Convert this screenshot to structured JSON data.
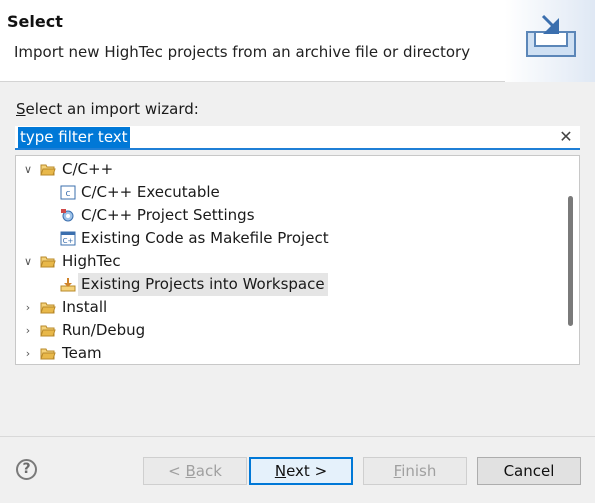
{
  "header": {
    "title": "Select",
    "description": "Import new HighTec projects from an archive file or directory"
  },
  "prompt": {
    "prefix": "S",
    "rest": "elect an import wizard:"
  },
  "filter": {
    "value": "type filter text",
    "clear": "✕"
  },
  "tree": {
    "items": [
      {
        "label": "C/C++",
        "type": "folder",
        "expanded": true
      },
      {
        "label": "C/C++ Executable",
        "type": "item"
      },
      {
        "label": "C/C++ Project Settings",
        "type": "item"
      },
      {
        "label": "Existing Code as Makefile Project",
        "type": "item"
      },
      {
        "label": "HighTec",
        "type": "folder",
        "expanded": true
      },
      {
        "label": "Existing Projects into Workspace",
        "type": "item",
        "selected": true
      },
      {
        "label": "Install",
        "type": "folder",
        "expanded": false
      },
      {
        "label": "Run/Debug",
        "type": "folder",
        "expanded": false
      },
      {
        "label": "Team",
        "type": "folder",
        "expanded": false
      }
    ]
  },
  "buttons": {
    "help": "?",
    "back_prefix": "< ",
    "back_mnemonic": "B",
    "back_rest": "ack",
    "next_mnemonic": "N",
    "next_rest": "ext >",
    "finish_mnemonic": "F",
    "finish_rest": "inish",
    "cancel": "Cancel"
  },
  "colors": {
    "accent": "#0078d7",
    "folder": "#e8b84a",
    "selected_row": "#e5e5e5"
  }
}
